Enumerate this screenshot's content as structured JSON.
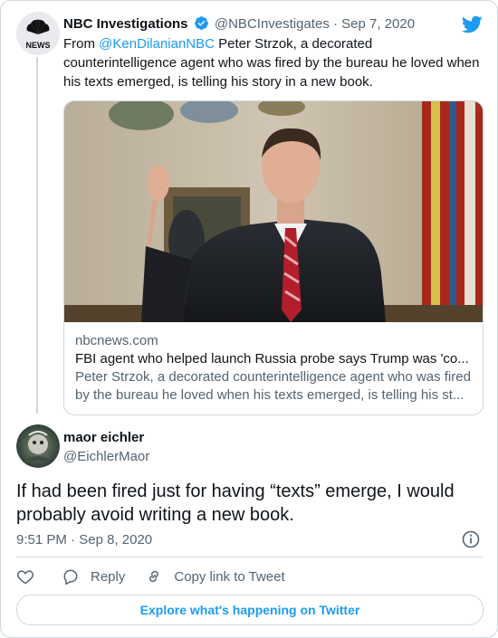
{
  "parent_tweet": {
    "avatar_text": "NEWS",
    "name": "NBC Investigations",
    "handle": "@NBCInvestigates",
    "separator": "·",
    "date": "Sep 7, 2020",
    "text_prefix": "From ",
    "mention": "@KenDilanianNBC",
    "text_rest": " Peter Strzok, a decorated counterintelligence agent who was fired by the bureau he loved when his texts emerged, is telling his story in a new book.",
    "link_card": {
      "domain": "nbcnews.com",
      "title": "FBI agent who helped launch Russia probe says Trump was 'co...",
      "description": "Peter Strzok, a decorated counterintelligence agent who was fired by the bureau he loved when his texts emerged, is telling his st..."
    }
  },
  "main_tweet": {
    "name": "maor eichler",
    "handle": "@EichlerMaor",
    "text": "If had been fired just for having “texts” emerge, I would probably avoid writing a new book.",
    "time": "9:51 PM",
    "separator": "·",
    "date": "Sep 8, 2020"
  },
  "actions": {
    "reply_label": "Reply",
    "copy_link_label": "Copy link to Tweet"
  },
  "explore_label": "Explore what's happening on Twitter",
  "colors": {
    "accent": "#1d9bf0",
    "secondary_text": "#536471",
    "border": "#cfd9de"
  },
  "icons": [
    "nbc-peacock-icon",
    "verified-badge-icon",
    "twitter-bird-icon",
    "info-icon",
    "heart-icon",
    "reply-icon",
    "link-icon"
  ]
}
